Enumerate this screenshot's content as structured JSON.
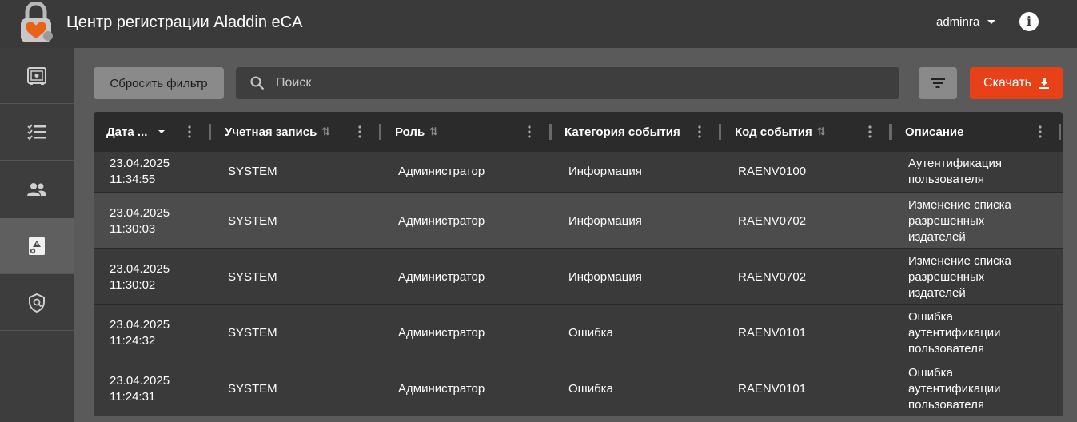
{
  "app": {
    "title": "Центр регистрации Aladdin eCA",
    "user": "adminra"
  },
  "colors": {
    "accent": "#e84118",
    "topbar": "#3a3a3a",
    "sidebar": "#3d3d3d",
    "background": "#5a5a5a"
  },
  "sidebar": {
    "items": [
      {
        "icon": "safe-icon"
      },
      {
        "icon": "checklist-icon"
      },
      {
        "icon": "users-icon"
      },
      {
        "icon": "audit-log-icon",
        "active": true
      },
      {
        "icon": "shield-user-icon"
      }
    ]
  },
  "toolbar": {
    "reset_filter_label": "Сбросить фильтр",
    "search_placeholder": "Поиск",
    "download_label": "Скачать"
  },
  "table": {
    "columns": [
      {
        "label": "Дата ...",
        "sort": "desc"
      },
      {
        "label": "Учетная запись",
        "sort": "none"
      },
      {
        "label": "Роль",
        "sort": "none"
      },
      {
        "label": "Категория события"
      },
      {
        "label": "Код события",
        "sort": "none"
      },
      {
        "label": "Описание"
      }
    ],
    "rows": [
      {
        "date": "23.04.2025",
        "time": "11:34:55",
        "account": "SYSTEM",
        "role": "Администратор",
        "category": "Информация",
        "code": "RAENV0100",
        "desc": [
          "Аутентификация",
          "пользователя"
        ]
      },
      {
        "date": "23.04.2025",
        "time": "11:30:03",
        "account": "SYSTEM",
        "role": "Администратор",
        "category": "Информация",
        "code": "RAENV0702",
        "desc": [
          "Изменение списка",
          "разрешенных",
          "издателей"
        ]
      },
      {
        "date": "23.04.2025",
        "time": "11:30:02",
        "account": "SYSTEM",
        "role": "Администратор",
        "category": "Информация",
        "code": "RAENV0702",
        "desc": [
          "Изменение списка",
          "разрешенных",
          "издателей"
        ]
      },
      {
        "date": "23.04.2025",
        "time": "11:24:32",
        "account": "SYSTEM",
        "role": "Администратор",
        "category": "Ошибка",
        "code": "RAENV0101",
        "desc": [
          "Ошибка",
          "аутентификации",
          "пользователя"
        ]
      },
      {
        "date": "23.04.2025",
        "time": "11:24:31",
        "account": "SYSTEM",
        "role": "Администратор",
        "category": "Ошибка",
        "code": "RAENV0101",
        "desc": [
          "Ошибка",
          "аутентификации",
          "пользователя"
        ]
      }
    ]
  }
}
